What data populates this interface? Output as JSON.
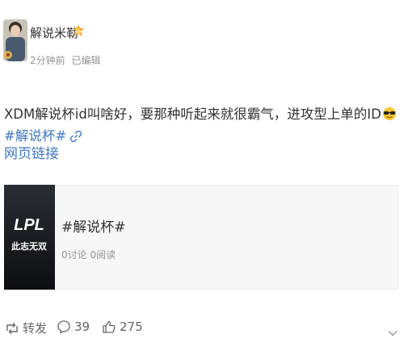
{
  "post": {
    "username": "解说米勒",
    "time": "2分钟前",
    "edited": "已编辑",
    "text_main": "XDM解说杯id叫啥好，要那种听起来就很霸气，进攻型上单的ID",
    "topic": "#解说杯#",
    "link_label": "网页链接"
  },
  "card": {
    "title": "#解说杯#",
    "discussions": "0讨论",
    "reads": "0阅读",
    "thumb_logo": "LPL",
    "thumb_sub": "此志无双"
  },
  "actions": {
    "repost_label": "转发",
    "comment_count": "39",
    "like_count": "275"
  },
  "icons": [
    "avatar-image",
    "verified-badge-icon",
    "sunglasses-emoji-icon",
    "link-icon",
    "repost-icon",
    "comment-icon",
    "like-icon",
    "more-icon"
  ],
  "colors": {
    "link": "#3f76c6",
    "meta": "#939393",
    "card_bg": "#f7f7f7",
    "badge": "#f5a623"
  }
}
